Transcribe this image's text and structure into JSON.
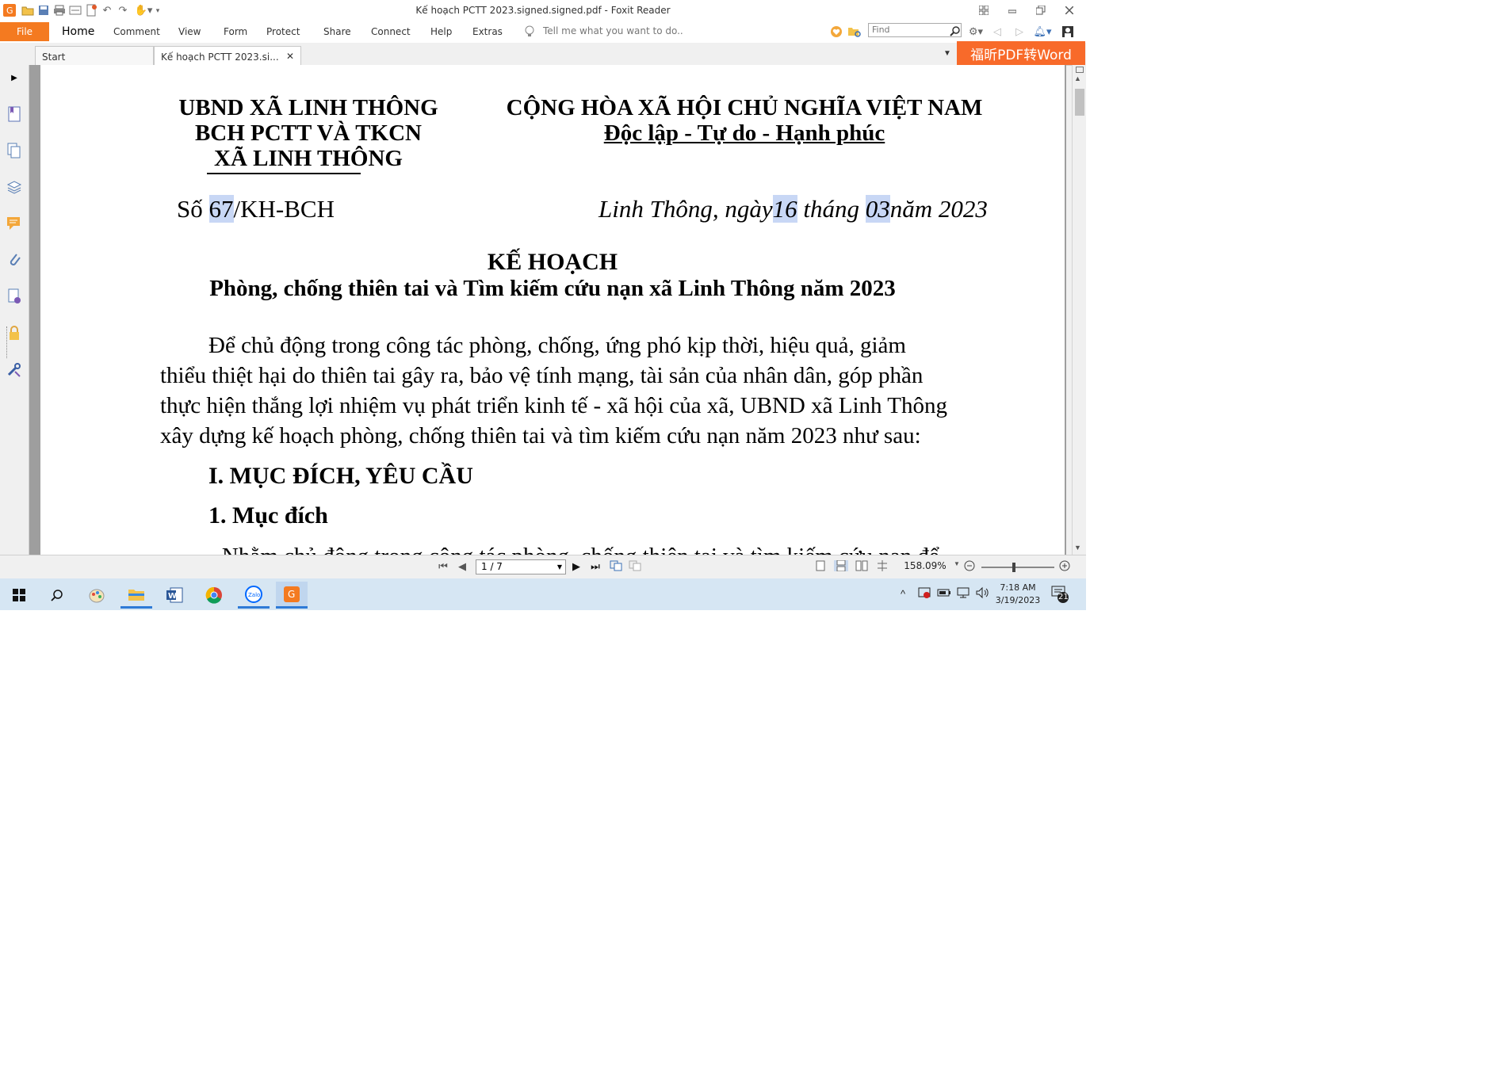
{
  "window": {
    "title": "Kế hoạch PCTT 2023.signed.signed.pdf - Foxit Reader"
  },
  "ribbon": {
    "file_label": "File",
    "tabs": [
      "Home",
      "Comment",
      "View",
      "Form",
      "Protect",
      "Share",
      "Connect",
      "Help",
      "Extras"
    ],
    "tell_me_placeholder": "Tell me what you want to do..",
    "find_placeholder": "Find"
  },
  "doc_tabs": [
    {
      "label": "Start"
    },
    {
      "label": "Kế hoạch PCTT 2023.si..."
    }
  ],
  "promo_label": "福昕PDF转Word",
  "document": {
    "org_line1": "UBND XÃ LINH THÔNG",
    "org_line2": "BCH PCTT VÀ TKCN",
    "org_line3": "XÃ LINH THÔNG",
    "nation_line1": "CỘNG HÒA XÃ HỘI CHỦ NGHĨA VIỆT NAM",
    "nation_line2": "Độc lập - Tự do - Hạnh phúc",
    "number_prefix": "Số ",
    "number_value": "67",
    "number_suffix": "/KH-BCH",
    "date_prefix": "Linh Thông, ngày",
    "date_day": "16",
    "date_month_word": " tháng ",
    "date_month": "03",
    "date_year": "năm 2023",
    "title": "KẾ HOẠCH",
    "subtitle": "Phòng, chống thiên tai và Tìm kiếm cứu nạn xã Linh Thông năm 2023",
    "para_line1": "Để chủ động trong công tác phòng, chống, ứng phó kịp thời, hiệu quả, giảm",
    "para_line2": "thiểu thiệt hại do thiên tai gây ra, bảo vệ tính mạng, tài sản của nhân dân, góp phần",
    "para_line3": "thực hiện thắng lợi nhiệm vụ phát triển kinh tế - xã hội của xã, UBND xã Linh Thông",
    "para_line4": "xây dựng kế hoạch phòng, chống thiên tai và tìm kiếm cứu nạn năm 2023 như sau:",
    "section1": "I. MỤC ĐÍCH, YÊU CẦU",
    "subsection1": "1. Mục đích",
    "partial_line": "- Nhằm chủ động trong công tác phòng, chống thiên tai và tìm kiếm cứu nạn để"
  },
  "status": {
    "page": "1 / 7",
    "zoom": "158.09%",
    "zoom_level_percent": 158.09
  },
  "taskbar": {
    "time": "7:18 AM",
    "date": "3/19/2023",
    "notifications": "21"
  },
  "colors": {
    "accent_orange": "#f47a20",
    "promo_orange": "#f86a2a",
    "highlight": "#c8d7f5",
    "taskbar_bg": "#d6e6f3"
  }
}
